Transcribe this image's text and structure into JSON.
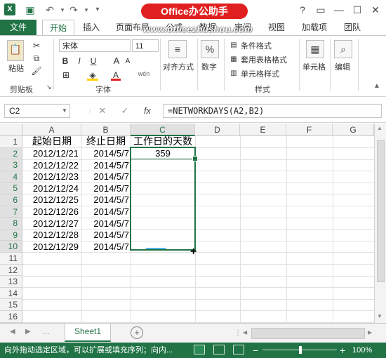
{
  "title_bar": {
    "app_logo": "X",
    "watermark_badge": "Office办公助手",
    "controls": {
      "help": "?",
      "restore": "▭",
      "minimize": "—",
      "maximize": "☐",
      "close": "✕"
    }
  },
  "tabs": [
    "文件",
    "开始",
    "插入",
    "页面布局",
    "公式",
    "数据",
    "审阅",
    "视图",
    "加载项",
    "团队"
  ],
  "watermark_url": "www.officezhushou.com",
  "ribbon": {
    "clipboard": {
      "paste": "粘贴",
      "label": "剪贴板"
    },
    "font": {
      "name": "宋体",
      "size": "11",
      "label": "字体",
      "bold": "B",
      "italic": "I",
      "underline": "U",
      "grow": "A",
      "shrink": "A",
      "font_color": "A",
      "wen": "wén"
    },
    "alignment": {
      "label": "对齐方式"
    },
    "number": {
      "label": "数字",
      "icon": "%"
    },
    "styles": {
      "conditional": "条件格式",
      "table": "套用表格格式",
      "cell_styles": "单元格样式",
      "label": "样式"
    },
    "cells": {
      "label": "单元格"
    },
    "editing": {
      "label": "编辑"
    }
  },
  "formula_bar": {
    "name_box": "C2",
    "cancel": "✕",
    "enter": "✓",
    "fx": "fx",
    "formula": "=NETWORKDAYS(A2,B2)"
  },
  "columns": [
    "A",
    "B",
    "C",
    "D",
    "E",
    "F",
    "G"
  ],
  "rows": [
    "1",
    "2",
    "3",
    "4",
    "5",
    "6",
    "7",
    "8",
    "9",
    "10",
    "11",
    "12",
    "13",
    "14",
    "15",
    "16"
  ],
  "cells": {
    "headers": [
      "起始日期",
      "终止日期",
      "工作日的天数"
    ],
    "start_dates": [
      "2012/12/21",
      "2012/12/22",
      "2012/12/23",
      "2012/12/24",
      "2012/12/25",
      "2012/12/26",
      "2012/12/27",
      "2012/12/28",
      "2012/12/29"
    ],
    "end_dates": [
      "2014/5/7",
      "2014/5/7",
      "2014/5/7",
      "2014/5/7",
      "2014/5/7",
      "2014/5/7",
      "2014/5/7",
      "2014/5/7",
      "2014/5/7"
    ],
    "c2": "359"
  },
  "sheet_tabs": {
    "active": "Sheet1",
    "add": "+"
  },
  "status_bar": {
    "message": "向外拖动选定区域，可以扩展或填充序列；向内...",
    "zoom": "100%",
    "zoom_minus": "−",
    "zoom_plus": "+"
  },
  "colors": {
    "accent": "#217346",
    "badge": "#e02020"
  }
}
